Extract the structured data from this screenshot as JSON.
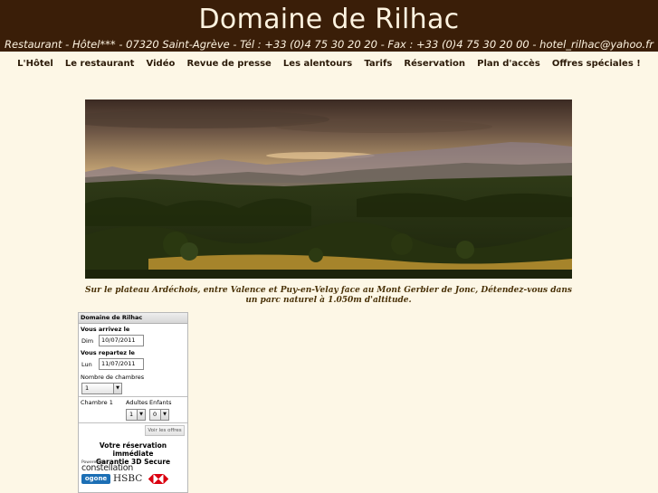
{
  "header": {
    "title": "Domaine de Rilhac",
    "contact": "Restaurant - Hôtel*** - 07320 Saint-Agrève - Tél : +33 (0)4 75 30 20 20 - Fax : +33 (0)4 75 30 20 00 - hotel_rilhac@yahoo.fr"
  },
  "nav": {
    "items": [
      "L'Hôtel",
      "Le restaurant",
      "Vidéo",
      "Revue de presse",
      "Les alentours",
      "Tarifs",
      "Réservation",
      "Plan d'accès",
      "Offres spéciales !"
    ]
  },
  "banner": {
    "caption": "Sur le plateau Ardéchois, entre Valence et Puy-en-Velay face au Mont Gerbier de Jonc, Détendez-vous dans un parc naturel à 1.050m d'altitude."
  },
  "booking": {
    "header": "Domaine de Rilhac",
    "arrive_label": "Vous arrivez le",
    "arrive_day": "Dim",
    "arrive_date": "10/07/2011",
    "depart_label": "Vous repartez le",
    "depart_day": "Lun",
    "depart_date": "11/07/2011",
    "rooms_label": "Nombre de chambres",
    "rooms_value": "1",
    "room_name": "Chambre 1",
    "adults_label": "Adultes",
    "children_label": "Enfants",
    "adults_value": "1",
    "children_value": "0",
    "offers_button": "Voir les offres",
    "secure_line1": "Votre réservation immédiate",
    "secure_line2": "Garantie 3D Secure",
    "powered_by": "Powered by",
    "constellation": "constellation",
    "ogone": "ogone",
    "hsbc": "HSBC"
  },
  "colors": {
    "header_bg": "#3a1e08",
    "page_bg": "#fdf7e6",
    "nav_text": "#2b1a08",
    "caption_text": "#4a3208",
    "ogone_blue": "#1c6fb5",
    "hsbc_red": "#db0011"
  }
}
